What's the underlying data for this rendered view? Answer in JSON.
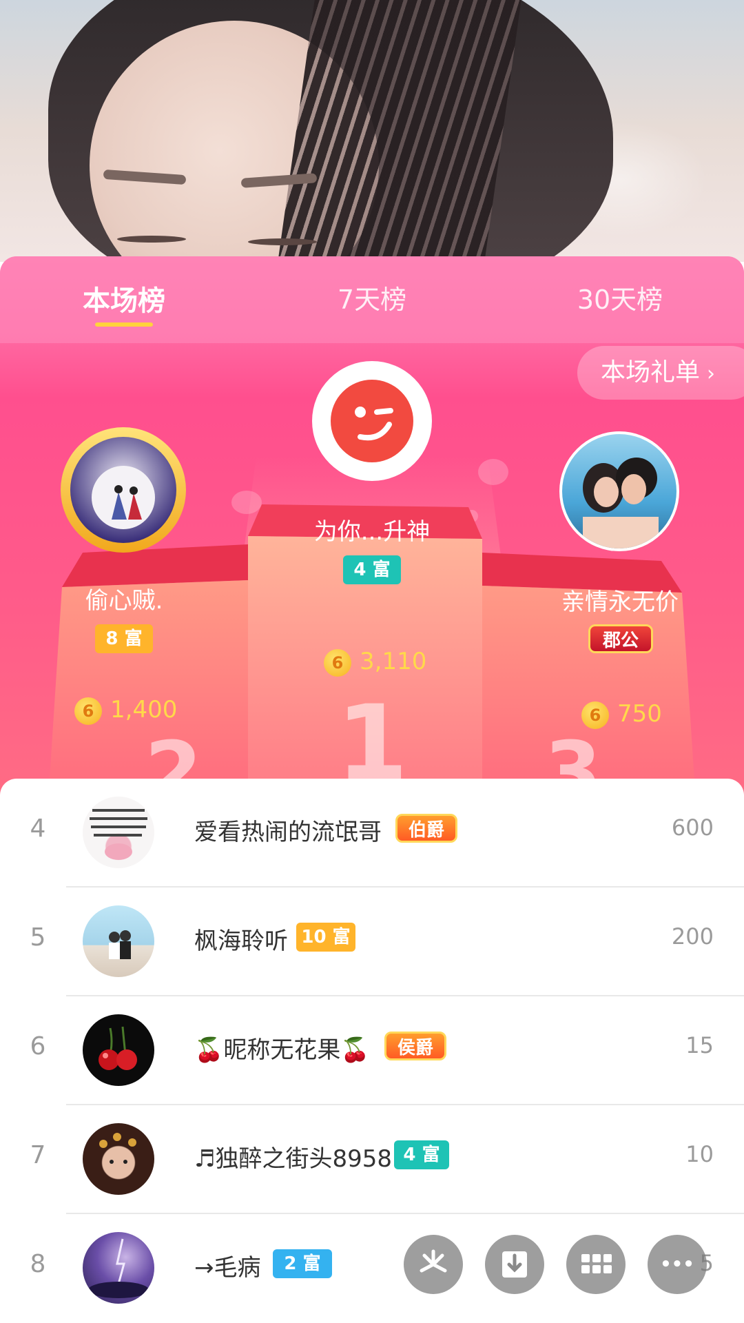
{
  "tabs": [
    {
      "label": "本场榜"
    },
    {
      "label": "7天榜"
    },
    {
      "label": "30天榜"
    }
  ],
  "gift_list_button": {
    "label": "本场礼单",
    "chevron": "›"
  },
  "podium": {
    "first": {
      "name": "为你...升神",
      "badge": "4 富",
      "coins": "3,110"
    },
    "second": {
      "name": "偷心贼.",
      "badge": "8 富",
      "coins": "1,400"
    },
    "third": {
      "name": "亲情永无价",
      "badge": "郡公",
      "coins": "750"
    },
    "coin_glyph": "6",
    "numbers": [
      "1",
      "2",
      "3"
    ]
  },
  "list": [
    {
      "rank": "4",
      "name": "爱看热闹的流氓哥",
      "badge": "伯爵",
      "score": "600"
    },
    {
      "rank": "5",
      "name": "枫海聆听",
      "badge": "10 富",
      "score": "200"
    },
    {
      "rank": "6",
      "name": "🍒昵称无花果🍒",
      "badge": "侯爵",
      "score": "15"
    },
    {
      "rank": "7",
      "name": "♬独醉之街头8958",
      "badge": "4 富",
      "score": "10"
    },
    {
      "rank": "8",
      "name": "→毛病",
      "badge": "2 富",
      "score": "5"
    }
  ],
  "fabs": [
    {
      "icon": "pinwheel-icon"
    },
    {
      "icon": "download-icon"
    },
    {
      "icon": "grid-icon"
    },
    {
      "icon": "more-icon",
      "glyph": "•••"
    }
  ],
  "colors": {
    "accent_pink": "#ff4f8e",
    "underline": "#ffd33c",
    "coin_text": "#ffd94a"
  }
}
